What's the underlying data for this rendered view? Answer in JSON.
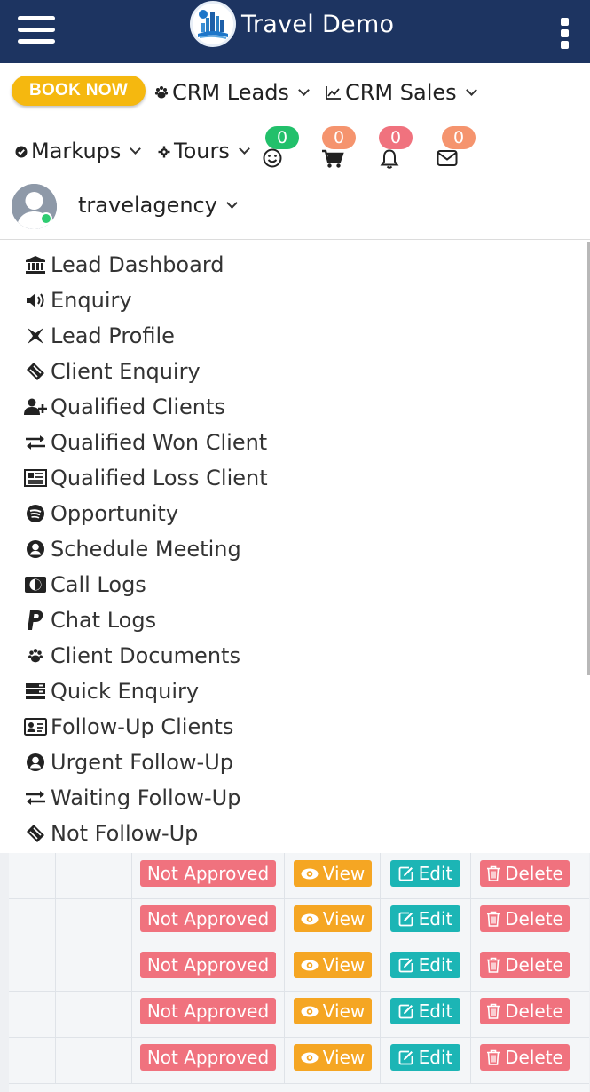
{
  "header": {
    "brand_title": "Travel Demo",
    "background": "#1d3461"
  },
  "nav": {
    "book_now": "BOOK NOW",
    "crm_leads": "CRM Leads",
    "crm_sales": "CRM Sales",
    "markups": "Markups",
    "tours": "Tours"
  },
  "notifications": [
    {
      "icon": "smiley-icon",
      "count": "0",
      "color": "#22c06b"
    },
    {
      "icon": "cart-icon",
      "count": "0",
      "color": "#f5946e"
    },
    {
      "icon": "bell-icon",
      "count": "0",
      "color": "#f0727e"
    },
    {
      "icon": "envelope-icon",
      "count": "0",
      "color": "#f5946e"
    }
  ],
  "user": {
    "name": "travelagency",
    "status_color": "#2ecc71"
  },
  "menu": {
    "items": [
      {
        "label": "Lead Dashboard",
        "icon": "bank-icon"
      },
      {
        "label": "Enquiry",
        "icon": "megaphone-icon"
      },
      {
        "label": "Lead Profile",
        "icon": "profile-icon"
      },
      {
        "label": "Client Enquiry",
        "icon": "ticket-icon"
      },
      {
        "label": "Qualified Clients",
        "icon": "user-plus-icon"
      },
      {
        "label": "Qualified Won Client",
        "icon": "exchange-icon"
      },
      {
        "label": "Qualified Loss Client",
        "icon": "newspaper-icon"
      },
      {
        "label": "Opportunity",
        "icon": "spotify-icon"
      },
      {
        "label": "Schedule Meeting",
        "icon": "user-circle-icon"
      },
      {
        "label": "Call Logs",
        "icon": "diners-card-icon"
      },
      {
        "label": "Chat Logs",
        "icon": "paypal-icon"
      },
      {
        "label": "Client Documents",
        "icon": "paw-icon"
      },
      {
        "label": "Quick Enquiry",
        "icon": "server-icon"
      },
      {
        "label": "Follow-Up Clients",
        "icon": "id-card-icon"
      },
      {
        "label": "Urgent Follow-Up",
        "icon": "user-circle-icon"
      },
      {
        "label": "Waiting Follow-Up",
        "icon": "exchange-icon"
      },
      {
        "label": "Not Follow-Up",
        "icon": "ticket-icon"
      }
    ]
  },
  "table": {
    "rows": [
      {
        "status": "Not Approved",
        "view": "View",
        "edit": "Edit",
        "delete": "Delete"
      },
      {
        "status": "Not Approved",
        "view": "View",
        "edit": "Edit",
        "delete": "Delete"
      },
      {
        "status": "Not Approved",
        "view": "View",
        "edit": "Edit",
        "delete": "Delete"
      },
      {
        "status": "Not Approved",
        "view": "View",
        "edit": "Edit",
        "delete": "Delete"
      },
      {
        "status": "Not Approved",
        "view": "View",
        "edit": "Edit",
        "delete": "Delete"
      }
    ]
  }
}
